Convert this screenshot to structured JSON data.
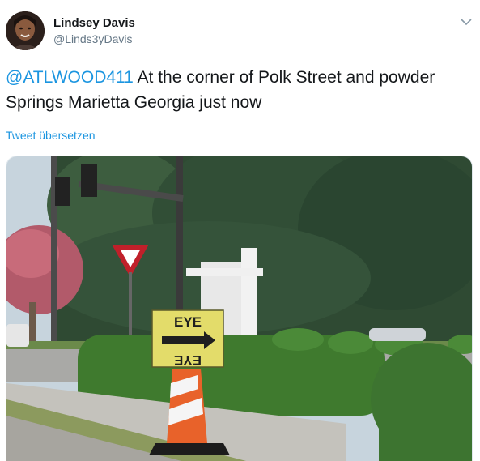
{
  "user": {
    "display_name": "Lindsey Davis",
    "handle": "@Linds3yDavis"
  },
  "tweet": {
    "mention": "@ATLWOOD411",
    "text": " At the corner of Polk Street and powder Springs Marietta Georgia just now",
    "translate_link": "Tweet übersetzen"
  },
  "media": {
    "sign_top": "EYE",
    "sign_bottom": "EYE"
  },
  "colors": {
    "link": "#1b95e0",
    "secondary_text": "#657786",
    "sign_yellow": "#e3dc6a",
    "cone_orange": "#e8622a"
  },
  "icons": {
    "menu": "chevron-down-icon"
  }
}
